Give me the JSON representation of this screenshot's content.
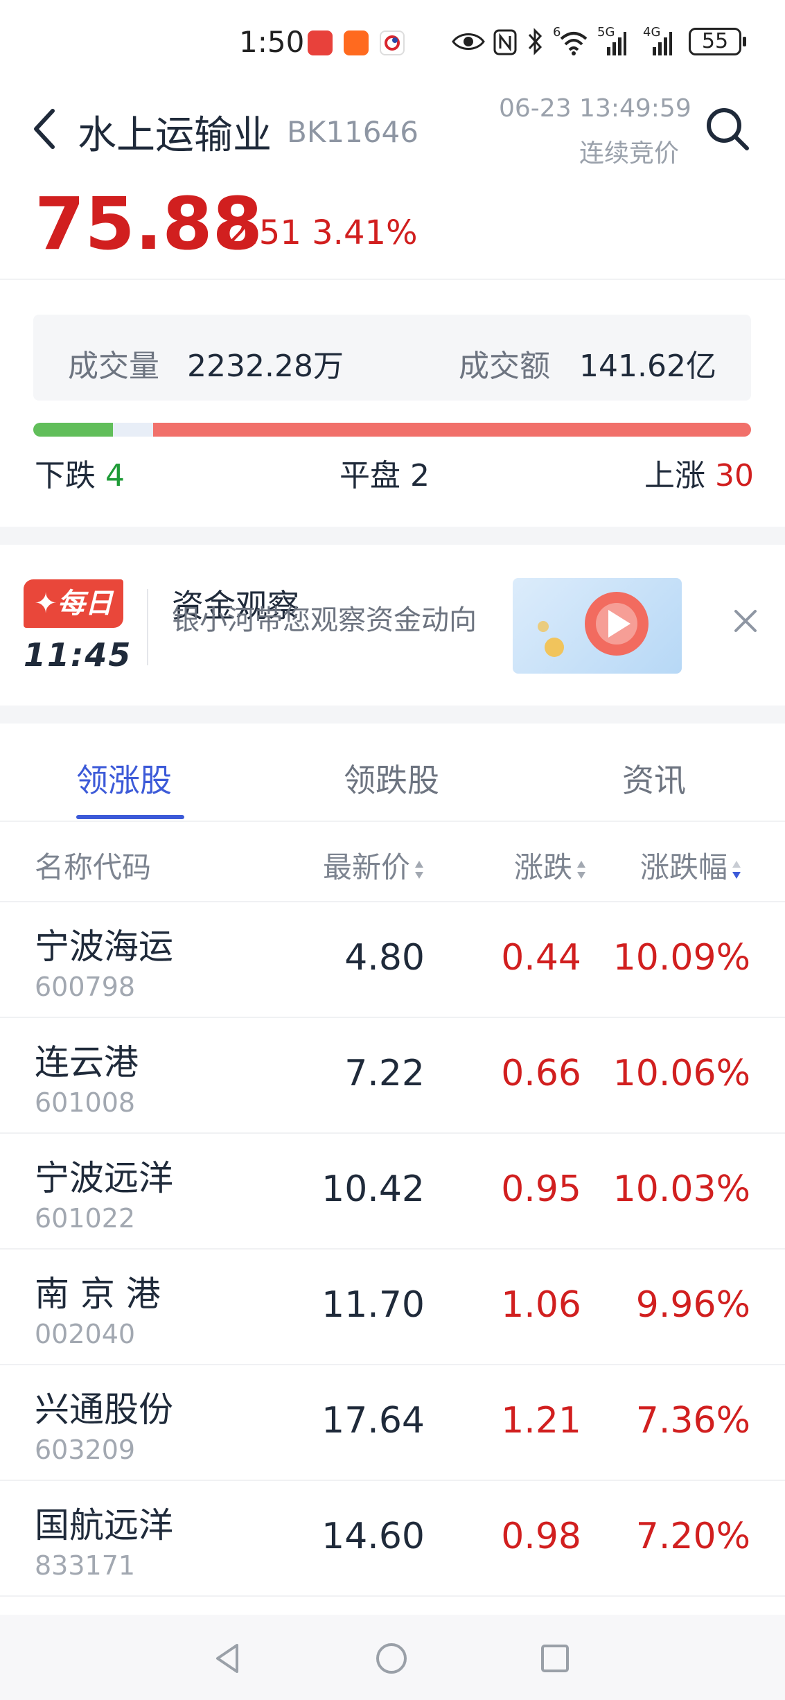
{
  "status_bar": {
    "time": "1:50",
    "battery": "55",
    "app_icons": [
      "huawei-appgallery-icon",
      "kuaishou-icon",
      "app-icon"
    ],
    "system_icons": [
      "eye-icon",
      "nfc-icon",
      "bluetooth-icon",
      "wifi-icon",
      "signal-5g-icon",
      "signal-4g-icon"
    ],
    "labels": {
      "wifi": "6",
      "sim1": "5G",
      "sim2": "4G"
    }
  },
  "header": {
    "title": "水上运输业",
    "code": "BK11646",
    "timestamp": "06-23 13:49:59",
    "trade_status": "连续竞价"
  },
  "quote": {
    "price": "75.88",
    "change": "2.51",
    "change_pct": "3.41%",
    "color_up": "#d11f1f"
  },
  "volume": {
    "volume_label": "成交量",
    "volume_value": "2232.28万",
    "amount_label": "成交额",
    "amount_value": "141.62亿"
  },
  "breadth": {
    "down_label": "下跌",
    "down_count": "4",
    "flat_label": "平盘",
    "flat_count": "2",
    "up_label": "上涨",
    "up_count": "30",
    "down_n": 4,
    "flat_n": 2,
    "up_n": 30,
    "down_color": "#61be5a",
    "flat_color": "#e8eef7",
    "up_color": "#f1706a"
  },
  "banner": {
    "badge": "✦每日",
    "badge_time": "11:45",
    "title": "资金观察",
    "subtitle": "银小河带您观察资金动向"
  },
  "tabs": [
    {
      "label": "领涨股",
      "active": true
    },
    {
      "label": "领跌股",
      "active": false
    },
    {
      "label": "资讯",
      "active": false
    }
  ],
  "table": {
    "columns": [
      "名称代码",
      "最新价",
      "涨跌",
      "涨跌幅"
    ],
    "rows": [
      {
        "name": "宁波海运",
        "code": "600798",
        "price": "4.80",
        "change": "0.44",
        "pct": "10.09%"
      },
      {
        "name": "连云港",
        "code": "601008",
        "price": "7.22",
        "change": "0.66",
        "pct": "10.06%"
      },
      {
        "name": "宁波远洋",
        "code": "601022",
        "price": "10.42",
        "change": "0.95",
        "pct": "10.03%"
      },
      {
        "name": "南 京 港",
        "code": "002040",
        "price": "11.70",
        "change": "1.06",
        "pct": "9.96%"
      },
      {
        "name": "兴通股份",
        "code": "603209",
        "price": "17.64",
        "change": "1.21",
        "pct": "7.36%"
      },
      {
        "name": "国航远洋",
        "code": "833171",
        "price": "14.60",
        "change": "0.98",
        "pct": "7.20%"
      }
    ]
  }
}
